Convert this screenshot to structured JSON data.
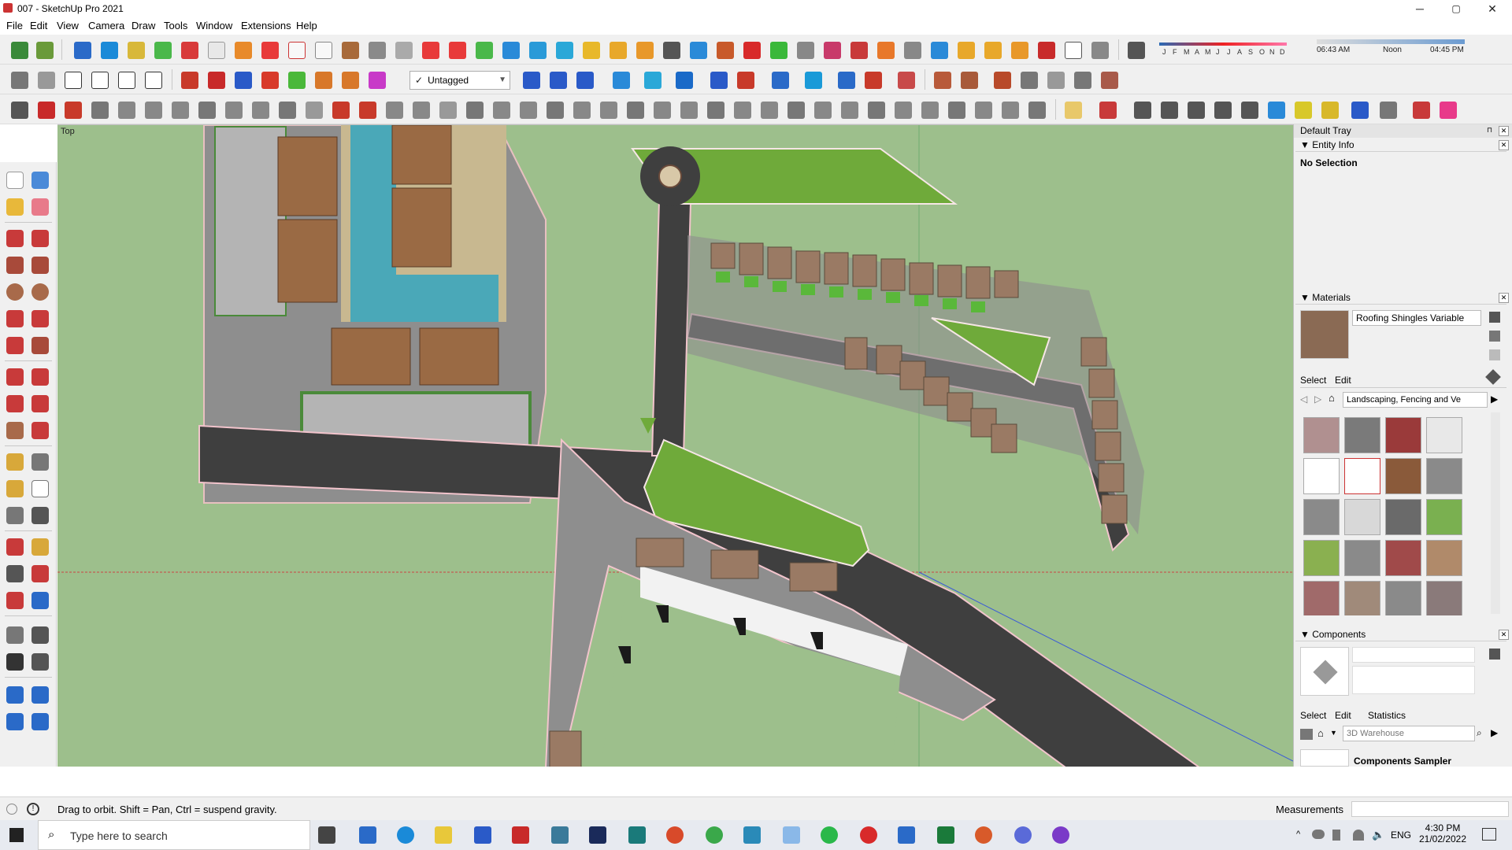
{
  "window": {
    "title": "007 - SketchUp Pro 2021",
    "minimize": "─",
    "maximize": "▢",
    "close": "✕"
  },
  "menu": [
    "File",
    "Edit",
    "View",
    "Camera",
    "Draw",
    "Tools",
    "Window",
    "Extensions",
    "Help"
  ],
  "tag_selector": {
    "value": "Untagged",
    "check": "✓"
  },
  "shadows": {
    "months": [
      "J",
      "F",
      "M",
      "A",
      "M",
      "J",
      "J",
      "A",
      "S",
      "O",
      "N",
      "D"
    ],
    "time_start": "06:43 AM",
    "time_mid": "Noon",
    "time_end": "04:45 PM"
  },
  "viewport": {
    "label": "Top"
  },
  "tray": {
    "title": "Default Tray",
    "entity_info": {
      "heading": "Entity Info",
      "value": "No Selection"
    },
    "materials": {
      "heading": "Materials",
      "current": "Roofing Shingles Variable",
      "tab_select": "Select",
      "tab_edit": "Edit",
      "library": "Landscaping, Fencing and Ve",
      "swatch_colors": [
        "#b09090",
        "#7a7a7a",
        "#9a3a3a",
        "#e8e8e8",
        "#ffffff",
        "#ffffff",
        "#8a5a3a",
        "#8a8a8a",
        "#8a8a8a",
        "#d8d8d8",
        "#6a6a6a",
        "#7ab050",
        "#8ab050",
        "#8a8a8a",
        "#a04a4a",
        "#b08a6a",
        "#a06a6a",
        "#a08a7a",
        "#8a8a8a",
        "#8a7a7a"
      ]
    },
    "components": {
      "heading": "Components",
      "tab_select": "Select",
      "tab_edit": "Edit",
      "tab_statistics": "Statistics",
      "search_placeholder": "3D Warehouse",
      "sampler": "Components Sampler"
    }
  },
  "status": {
    "message": "Drag to orbit. Shift = Pan, Ctrl = suspend gravity.",
    "measurements_label": "Measurements"
  },
  "taskbar": {
    "search_placeholder": "Type here to search",
    "language": "ENG",
    "time": "4:30 PM",
    "date": "21/02/2022"
  }
}
